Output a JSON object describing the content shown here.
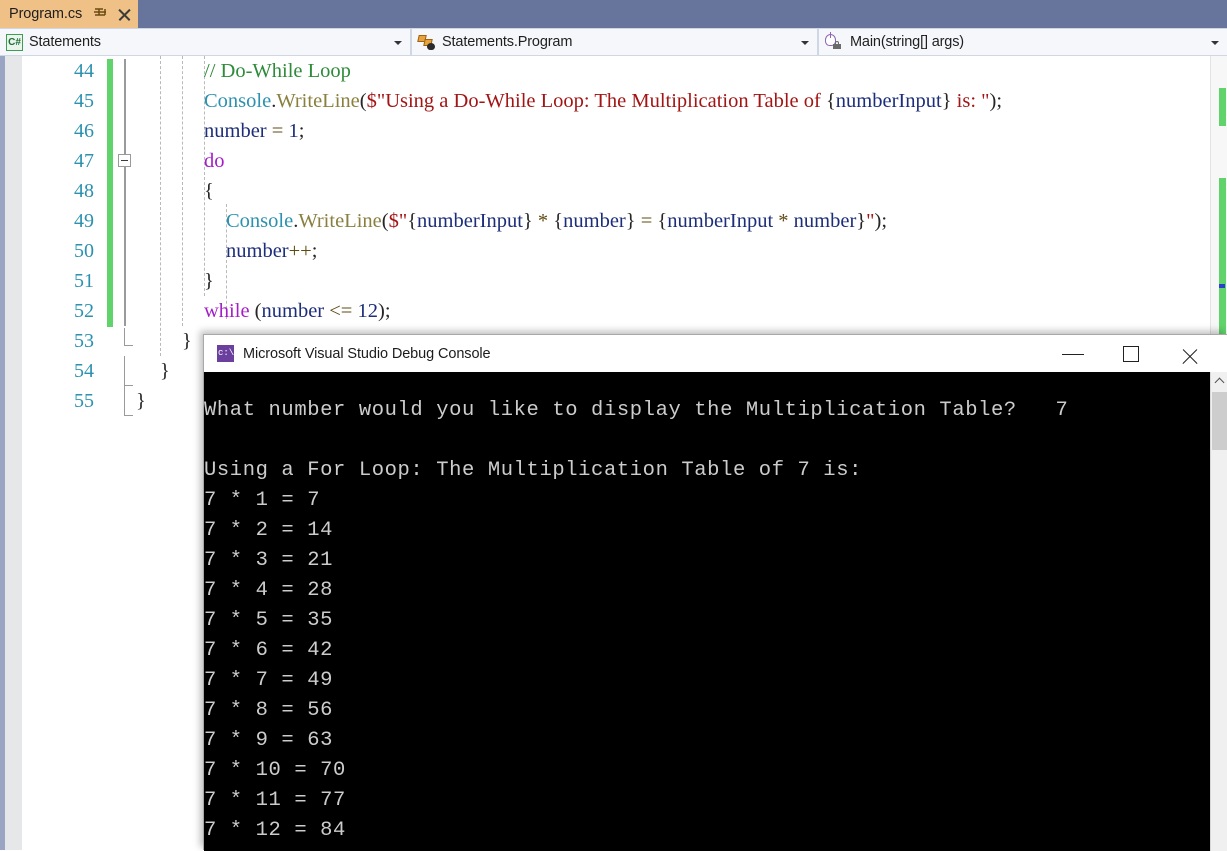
{
  "window": {
    "tab": {
      "title": "Program.cs",
      "pin_icon": "pin-icon",
      "close_icon": "close-icon"
    }
  },
  "navbar": {
    "project": {
      "icon": "csharp-file-icon",
      "label": "Statements"
    },
    "type": {
      "icon": "class-icon",
      "label": "Statements.Program"
    },
    "member": {
      "icon": "method-private-icon",
      "label": "Main(string[] args)"
    }
  },
  "editor": {
    "first_line": 44,
    "line_numbers": [
      44,
      45,
      46,
      47,
      48,
      49,
      50,
      51,
      52,
      53,
      54,
      55
    ],
    "lines": [
      {
        "n": 44,
        "tokens": [
          {
            "t": "// Do-While Loop",
            "c": "t-com"
          }
        ]
      },
      {
        "n": 45,
        "tokens": [
          {
            "t": "Console",
            "c": "t-type"
          },
          {
            "t": ".",
            "c": "t-pl"
          },
          {
            "t": "WriteLine",
            "c": "t-mth"
          },
          {
            "t": "(",
            "c": "t-pl"
          },
          {
            "t": "$\"Using a Do-While Loop: The Multiplication Table of ",
            "c": "t-str"
          },
          {
            "t": "{",
            "c": "t-brc"
          },
          {
            "t": "numberInput",
            "c": "t-id"
          },
          {
            "t": "}",
            "c": "t-brc"
          },
          {
            "t": " is: \"",
            "c": "t-str"
          },
          {
            "t": ");",
            "c": "t-pl"
          }
        ]
      },
      {
        "n": 46,
        "tokens": [
          {
            "t": "number",
            "c": "t-id"
          },
          {
            "t": " = ",
            "c": "t-op"
          },
          {
            "t": "1",
            "c": "t-num"
          },
          {
            "t": ";",
            "c": "t-pl"
          }
        ]
      },
      {
        "n": 47,
        "tokens": [
          {
            "t": "do",
            "c": "t-kw"
          }
        ]
      },
      {
        "n": 48,
        "tokens": [
          {
            "t": "{",
            "c": "t-pl"
          }
        ]
      },
      {
        "n": 49,
        "indent": 22,
        "tokens": [
          {
            "t": "Console",
            "c": "t-type"
          },
          {
            "t": ".",
            "c": "t-pl"
          },
          {
            "t": "WriteLine",
            "c": "t-mth"
          },
          {
            "t": "(",
            "c": "t-pl"
          },
          {
            "t": "$\"",
            "c": "t-str"
          },
          {
            "t": "{",
            "c": "t-brc"
          },
          {
            "t": "numberInput",
            "c": "t-id"
          },
          {
            "t": "}",
            "c": "t-brc"
          },
          {
            "t": " * ",
            "c": "t-op"
          },
          {
            "t": "{",
            "c": "t-brc"
          },
          {
            "t": "number",
            "c": "t-id"
          },
          {
            "t": "}",
            "c": "t-brc"
          },
          {
            "t": " = ",
            "c": "t-op"
          },
          {
            "t": "{",
            "c": "t-brc"
          },
          {
            "t": "numberInput",
            "c": "t-id"
          },
          {
            "t": " * ",
            "c": "t-op"
          },
          {
            "t": "number",
            "c": "t-id"
          },
          {
            "t": "}",
            "c": "t-brc"
          },
          {
            "t": "\"",
            "c": "t-str"
          },
          {
            "t": ");",
            "c": "t-pl"
          }
        ]
      },
      {
        "n": 50,
        "indent": 22,
        "tokens": [
          {
            "t": "number",
            "c": "t-id"
          },
          {
            "t": "++",
            "c": "t-op"
          },
          {
            "t": ";",
            "c": "t-pl"
          }
        ]
      },
      {
        "n": 51,
        "tokens": [
          {
            "t": "}",
            "c": "t-pl"
          }
        ]
      },
      {
        "n": 52,
        "tokens": [
          {
            "t": "while",
            "c": "t-kw"
          },
          {
            "t": " (",
            "c": "t-pl"
          },
          {
            "t": "number",
            "c": "t-id"
          },
          {
            "t": " <= ",
            "c": "t-op"
          },
          {
            "t": "12",
            "c": "t-num"
          },
          {
            "t": ");",
            "c": "t-pl"
          }
        ]
      },
      {
        "n": 53,
        "indent": -22,
        "tokens": [
          {
            "t": "}",
            "c": "t-pl"
          }
        ]
      },
      {
        "n": 54,
        "indent": -44,
        "tokens": [
          {
            "t": "}",
            "c": "t-pl"
          }
        ]
      },
      {
        "n": 55,
        "indent": -68,
        "tokens": [
          {
            "t": "}",
            "c": "t-pl"
          }
        ]
      }
    ],
    "colors": {
      "line_number": "#2b91af",
      "comment": "#2e8b39",
      "keyword": "#a41ec8",
      "type": "#2b91af",
      "method": "#8a7f3f",
      "string": "#a31515",
      "identifier": "#1c2e7a",
      "change_bar": "#60d36a",
      "background": "#ffffff"
    }
  },
  "console": {
    "title": "Microsoft Visual Studio Debug Console",
    "icon": "console-app-icon",
    "buttons": {
      "minimize": "minimize-icon",
      "maximize": "maximize-icon",
      "close": "close-icon"
    },
    "output": "What number would you like to display the Multiplication Table?   7\n\nUsing a For Loop: The Multiplication Table of 7 is:\n7 * 1 = 7\n7 * 2 = 14\n7 * 3 = 21\n7 * 4 = 28\n7 * 5 = 35\n7 * 6 = 42\n7 * 7 = 49\n7 * 8 = 56\n7 * 9 = 63\n7 * 10 = 70\n7 * 11 = 77\n7 * 12 = 84",
    "output_lines": [
      "What number would you like to display the Multiplication Table?   7",
      "",
      "Using a For Loop: The Multiplication Table of 7 is:",
      "7 * 1 = 7",
      "7 * 2 = 14",
      "7 * 3 = 21",
      "7 * 4 = 28",
      "7 * 5 = 35",
      "7 * 6 = 42",
      "7 * 7 = 49",
      "7 * 8 = 56",
      "7 * 9 = 63",
      "7 * 10 = 70",
      "7 * 11 = 77",
      "7 * 12 = 84"
    ],
    "user_input": "7",
    "multiplicand": 7,
    "text_color": "#cccccc",
    "background": "#000000"
  }
}
